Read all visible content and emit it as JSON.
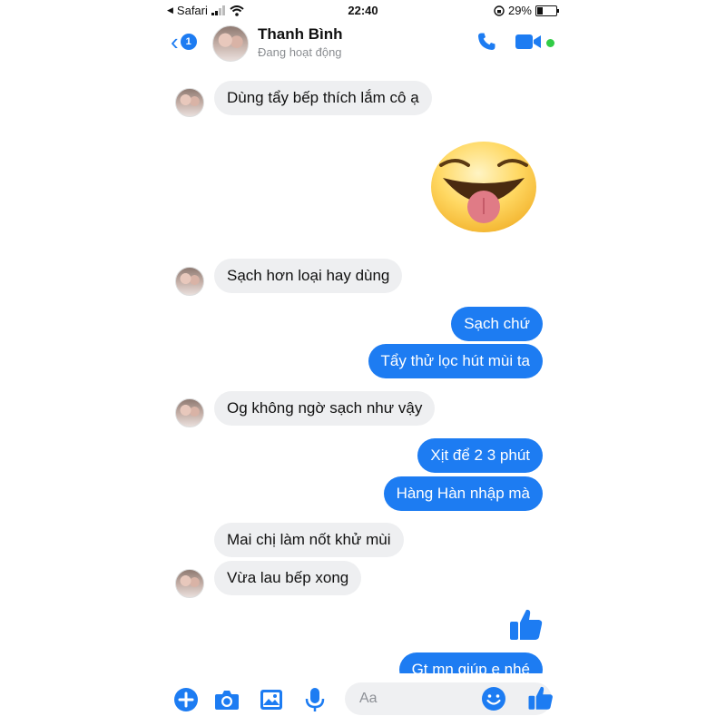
{
  "status_bar": {
    "carrier": "Safari",
    "time": "22:40",
    "battery": "29%",
    "battery_level": 0.29
  },
  "header": {
    "back_count": "1",
    "contact_name": "Thanh Bình",
    "contact_status": "Đang hoạt động"
  },
  "messages": {
    "m1": "Dùng tẩy bếp thích lắm cô ạ",
    "m2": "Sạch hơn loại hay dùng",
    "m3": "Sạch chứ",
    "m4": "Tẩy thử lọc hút mùi ta",
    "m5": "Og không ngờ sạch như vậy",
    "m6": "Xịt để 2 3 phút",
    "m7": "Hàng Hàn nhập mà",
    "m8": "Mai chị làm nốt khử mùi",
    "m9": "Vừa lau bếp xong",
    "m10": "Gt mn giúp e nhé"
  },
  "composer": {
    "placeholder": "Aa"
  },
  "colors": {
    "accent": "#1d7cf2",
    "incoming_bubble": "#eeeff1",
    "online": "#31cc46"
  }
}
